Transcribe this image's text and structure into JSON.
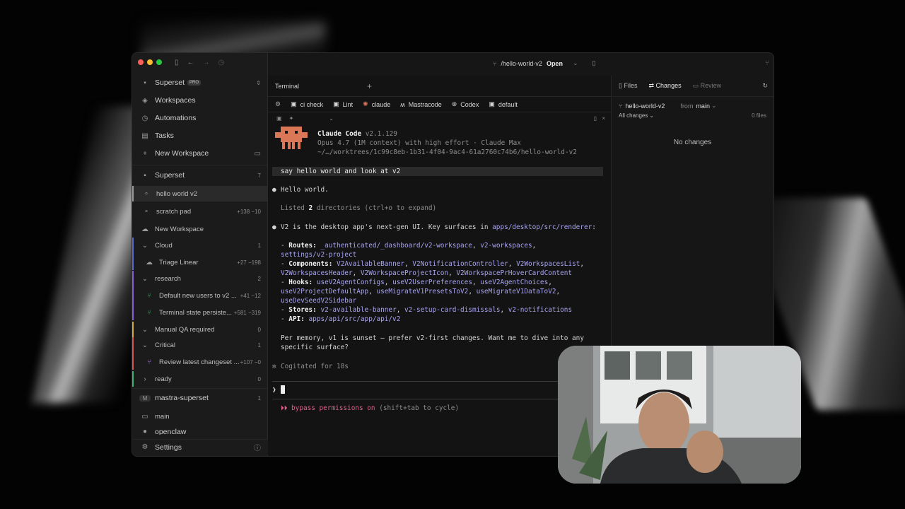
{
  "sidebar": {
    "org": "Superset",
    "org_badge": "PRO",
    "nav": [
      {
        "label": "Workspaces",
        "icon": "layers-icon"
      },
      {
        "label": "Automations",
        "icon": "clock-icon"
      },
      {
        "label": "Tasks",
        "icon": "book-icon"
      },
      {
        "label": "New Workspace",
        "icon": "plus-icon"
      }
    ],
    "group1": {
      "label": "Superset",
      "count": "7"
    },
    "items": [
      {
        "label": "hello world v2",
        "diff": ""
      },
      {
        "label": "scratch pad",
        "diff": "+138 −10"
      },
      {
        "label": "New Workspace",
        "diff": ""
      },
      {
        "label": "Cloud",
        "diff": "1"
      },
      {
        "label": "Triage Linear",
        "diff": "+27 −198"
      },
      {
        "label": "research",
        "diff": "2"
      },
      {
        "label": "Default new users to v2 ...",
        "diff": "+41 −12"
      },
      {
        "label": "Terminal state persiste...",
        "diff": "+581 −319"
      },
      {
        "label": "Manual QA required",
        "diff": "0"
      },
      {
        "label": "Critical",
        "diff": "1"
      },
      {
        "label": "Review latest changeset ...",
        "diff": "+107 −0"
      },
      {
        "label": "ready",
        "diff": "0"
      }
    ],
    "group2": {
      "label": "mastra-superset",
      "count": "1"
    },
    "group2_item": "main",
    "group3_partial": "openclaw",
    "settings": "Settings"
  },
  "topbar": {
    "branch": "/hello-world-v2",
    "open": "Open"
  },
  "tabs": {
    "terminal": "Terminal"
  },
  "presets": [
    "ci check",
    "Lint",
    "claude",
    "Mastracode",
    "Codex",
    "default"
  ],
  "terminal": {
    "app": "Claude Code",
    "version": "v2.1.129",
    "model": "Opus 4.7 (1M context) with high effort · Claude Max",
    "path": "~/…/worktrees/1c99c8eb-1b31-4f04-9ac4-61a2760c74b6/hello-world-v2",
    "prompt": "say hello world and look at v2",
    "reply1": "Hello world.",
    "listed_prefix": "Listed ",
    "listed_num": "2",
    "listed_suffix": " directories (ctrl+o to expand)",
    "v2_intro": "V2 is the desktop app's next-gen UI. Key surfaces in ",
    "v2_path": "apps/desktop/src/renderer",
    "v2_colon": ":",
    "routes_label": "Routes:",
    "routes_1": "_authenticated/_dashboard/v2-workspace",
    "routes_sep": ", ",
    "routes_2": "v2-workspaces",
    "routes_3": "settings/v2-project",
    "components_label": "Components:",
    "components_1": "V2AvailableBanner",
    "components_2": "V2NotificationController",
    "components_3": "V2WorkspacesList",
    "components_4": "V2WorkspacesHeader",
    "components_5": "V2WorkspaceProjectIcon",
    "components_6": "V2WorkspacePrHoverCardContent",
    "hooks_label": "Hooks:",
    "hooks_1": "useV2AgentConfigs",
    "hooks_2": "useV2UserPreferences",
    "hooks_3": "useV2AgentChoices",
    "hooks_4": "useV2ProjectDefaultApp",
    "hooks_5": "useMigrateV1PresetsToV2",
    "hooks_6": "useMigrateV1DataToV2",
    "hooks_7": "useDevSeedV2Sidebar",
    "stores_label": "Stores:",
    "stores_1": "v2-available-banner",
    "stores_2": "v2-setup-card-dismissals",
    "stores_3": "v2-notifications",
    "api_label": "API:",
    "api_1": "apps/api/src/app/api/v2",
    "memo1": "Per memory, v1 is sunset — prefer v2-first changes. Want me to dive into any",
    "memo2": "specific surface?",
    "cogitated": "Cogitated for 18s",
    "bypass_arrows": "⏵⏵ ",
    "bypass": "bypass permissions on",
    "bypass_hint": " (shift+tab to cycle)"
  },
  "right": {
    "tabs": [
      "Files",
      "Changes",
      "Review"
    ],
    "branch": "hello-world-v2",
    "from": "from",
    "base": "main",
    "filter": "All changes",
    "files": "0 files",
    "empty": "No changes"
  },
  "colors": {
    "accent": "#a9a5f2",
    "claude_orange": "#d97757"
  }
}
